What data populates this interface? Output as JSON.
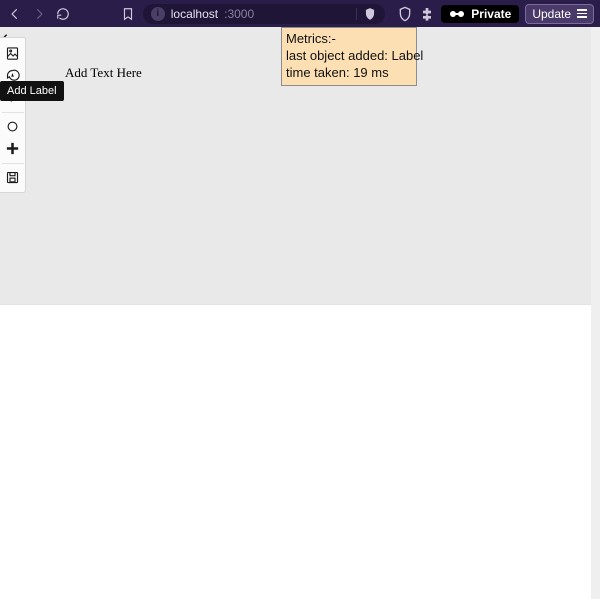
{
  "chrome": {
    "url_host": "localhost",
    "url_port": ":3000",
    "private_label": "Private",
    "update_label": "Update"
  },
  "toolbar": {
    "tooltip": "Add Label"
  },
  "canvas": {
    "text_label": "Add Text Here"
  },
  "metrics": {
    "heading": "Metrics:-",
    "last_object_line": "last object added: Label",
    "time_line": "time taken: 19 ms"
  }
}
